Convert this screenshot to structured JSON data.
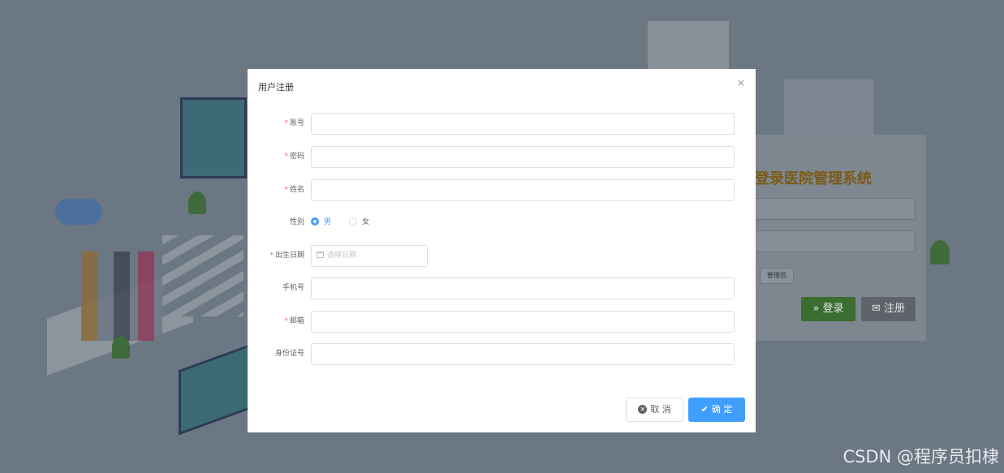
{
  "background": {
    "login_title": "登录医院管理系统",
    "admin_option": "管理员",
    "login_button": "登录",
    "register_button": "注册",
    "watermark": "CSDN @程序员扣棣"
  },
  "dialog": {
    "title": "用户注册",
    "close_icon": "×",
    "fields": {
      "account": {
        "label": "账号",
        "required": true,
        "value": ""
      },
      "password": {
        "label": "密码",
        "required": true,
        "value": ""
      },
      "name": {
        "label": "姓名",
        "required": true,
        "value": ""
      },
      "gender": {
        "label": "性别",
        "options": [
          "男",
          "女"
        ],
        "selected": "男"
      },
      "birthday": {
        "label": "出生日期",
        "required": true,
        "placeholder": "选择日期"
      },
      "phone": {
        "label": "手机号",
        "required": false,
        "value": ""
      },
      "email": {
        "label": "邮箱",
        "required": true,
        "value": ""
      },
      "id_card": {
        "label": "身份证号",
        "required": false,
        "value": ""
      }
    },
    "buttons": {
      "cancel": "取 消",
      "confirm": "确 定"
    }
  },
  "colors": {
    "primary": "#409eff",
    "required": "#f56c6c",
    "overlay": "#6c7784"
  }
}
